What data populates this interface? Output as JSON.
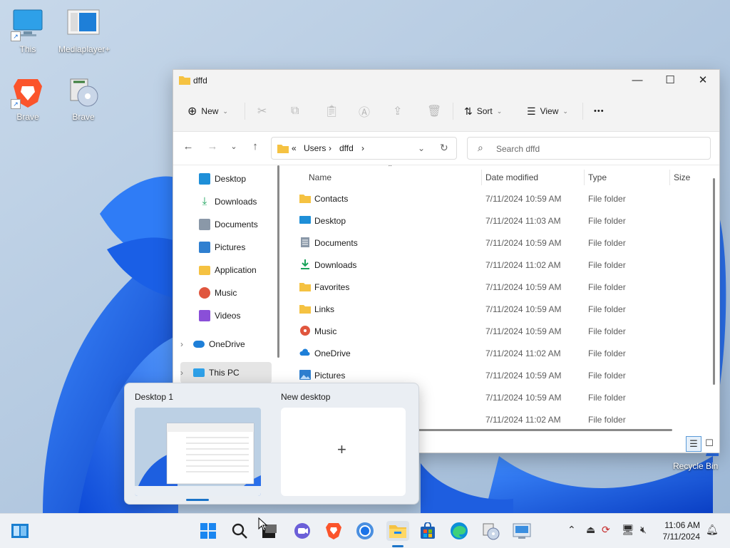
{
  "desktop_icons": [
    {
      "label": "This"
    },
    {
      "label": "Mediaplayer+"
    },
    {
      "label": "Brave"
    },
    {
      "label": "Brave"
    }
  ],
  "recycle_bin": {
    "label": "Recycle Bin"
  },
  "window": {
    "title": "dffd",
    "toolbar": {
      "new_label": "New",
      "sort_label": "Sort",
      "view_label": "View",
      "more": "•••"
    },
    "address": {
      "prefix": "«",
      "crumbs": [
        "Users",
        "dffd"
      ]
    },
    "search": {
      "placeholder": "Search dffd"
    },
    "nav": [
      {
        "label": "Desktop",
        "pinned": true
      },
      {
        "label": "Downloads",
        "pinned": true
      },
      {
        "label": "Documents",
        "pinned": true
      },
      {
        "label": "Pictures",
        "pinned": true
      },
      {
        "label": "Application",
        "pinned": false
      },
      {
        "label": "Music",
        "pinned": false
      },
      {
        "label": "Videos",
        "pinned": false
      },
      {
        "label": "OneDrive",
        "pinned": false
      },
      {
        "label": "This PC",
        "pinned": false
      }
    ],
    "columns": {
      "name": "Name",
      "date": "Date modified",
      "type": "Type",
      "size": "Size"
    },
    "files": [
      {
        "name": "Contacts",
        "date": "7/11/2024 10:59 AM",
        "type": "File folder"
      },
      {
        "name": "Desktop",
        "date": "7/11/2024 11:03 AM",
        "type": "File folder"
      },
      {
        "name": "Documents",
        "date": "7/11/2024 10:59 AM",
        "type": "File folder"
      },
      {
        "name": "Downloads",
        "date": "7/11/2024 11:02 AM",
        "type": "File folder"
      },
      {
        "name": "Favorites",
        "date": "7/11/2024 10:59 AM",
        "type": "File folder"
      },
      {
        "name": "Links",
        "date": "7/11/2024 10:59 AM",
        "type": "File folder"
      },
      {
        "name": "Music",
        "date": "7/11/2024 10:59 AM",
        "type": "File folder"
      },
      {
        "name": "OneDrive",
        "date": "7/11/2024 11:02 AM",
        "type": "File folder"
      },
      {
        "name": "Pictures",
        "date": "7/11/2024 10:59 AM",
        "type": "File folder"
      },
      {
        "name": "",
        "date": "7/11/2024 10:59 AM",
        "type": "File folder"
      },
      {
        "name": "",
        "date": "7/11/2024 11:02 AM",
        "type": "File folder"
      }
    ]
  },
  "task_view": {
    "desktops": [
      {
        "label": "Desktop 1"
      },
      {
        "label": "New desktop"
      }
    ],
    "plus": "+"
  },
  "taskbar": {
    "clock_time": "11:06 AM",
    "clock_date": "7/11/2024"
  },
  "colors": {
    "accent": "#1a73c8",
    "folder": "#f5c242",
    "wallpaper_blue": "#1d5fe0"
  }
}
